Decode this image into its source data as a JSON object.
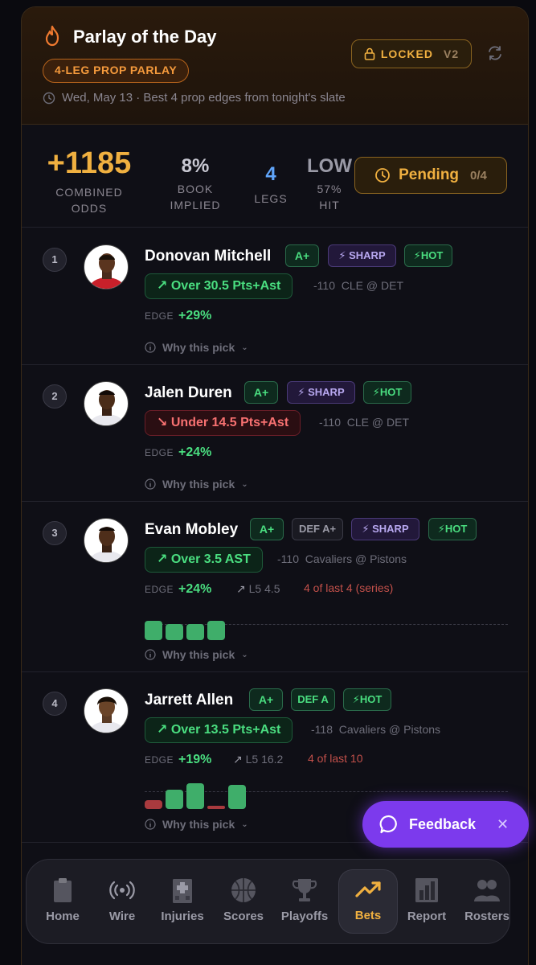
{
  "header": {
    "title": "Parlay of the Day",
    "badge": "4-LEG PROP PARLAY",
    "subtitle": "Wed, May 13 · Best 4 prop edges from tonight's slate",
    "locked_label": "LOCKED",
    "version": "V2"
  },
  "stats": {
    "combined_odds": "+1185",
    "combined_label_1": "COMBINED",
    "combined_label_2": "ODDS",
    "book_implied": "8%",
    "book_label_1": "BOOK",
    "book_label_2": "IMPLIED",
    "legs": "4",
    "legs_label": "LEGS",
    "risk": "LOW",
    "hit": "57%",
    "hit_label": "HIT",
    "status": "Pending",
    "status_count": "0/4"
  },
  "legs": [
    {
      "num": "1",
      "name": "Donovan Mitchell",
      "grade": "A+",
      "sharp": "⚡ SHARP",
      "hot": "HOT",
      "pick": "Over 30.5 Pts+Ast",
      "odds": "-110",
      "matchup": "CLE @ DET",
      "edge_label": "EDGE",
      "edge": "+29%",
      "why": "Why this pick"
    },
    {
      "num": "2",
      "name": "Jalen Duren",
      "grade": "A+",
      "sharp": "⚡ SHARP",
      "hot": "HOT",
      "pick": "Under 14.5 Pts+Ast",
      "odds": "-110",
      "matchup": "CLE @ DET",
      "edge_label": "EDGE",
      "edge": "+24%",
      "why": "Why this pick"
    },
    {
      "num": "3",
      "name": "Evan Mobley",
      "grade": "A+",
      "def": "DEF A+",
      "sharp": "⚡ SHARP",
      "hot": "HOT",
      "pick": "Over 3.5 AST",
      "odds": "-110",
      "matchup": "Cavaliers @ Pistons",
      "edge_label": "EDGE",
      "edge": "+24%",
      "l5": "L5 4.5",
      "streak": "4 of last 4 (series)",
      "why": "Why this pick"
    },
    {
      "num": "4",
      "name": "Jarrett Allen",
      "grade": "A+",
      "def": "DEF A",
      "hot": "HOT",
      "pick": "Over 13.5 Pts+Ast",
      "odds": "-118",
      "matchup": "Cavaliers @ Pistons",
      "edge_label": "EDGE",
      "edge": "+19%",
      "l5": "L5 16.2",
      "streak": "4 of last 10",
      "why": "Why this pick"
    }
  ],
  "recent_games": {
    "leg3": {
      "hit": [
        true,
        true,
        true,
        true
      ]
    },
    "leg4": {
      "hit": [
        false,
        true,
        true,
        false,
        true
      ]
    }
  },
  "nav": [
    {
      "label": "Home",
      "icon": "clipboard-icon"
    },
    {
      "label": "Wire",
      "icon": "broadcast-icon"
    },
    {
      "label": "Injuries",
      "icon": "hospital-icon"
    },
    {
      "label": "Scores",
      "icon": "basketball-icon"
    },
    {
      "label": "Playoffs",
      "icon": "trophy-icon"
    },
    {
      "label": "Bets",
      "icon": "trending-up-icon",
      "active": true
    },
    {
      "label": "Report",
      "icon": "bar-chart-icon"
    },
    {
      "label": "Rosters",
      "icon": "people-icon"
    }
  ],
  "feedback": {
    "label": "Feedback"
  },
  "colors": {
    "accent": "#f0b040",
    "green": "#4ade80",
    "red": "#f87171",
    "purple": "#7c3aed"
  }
}
